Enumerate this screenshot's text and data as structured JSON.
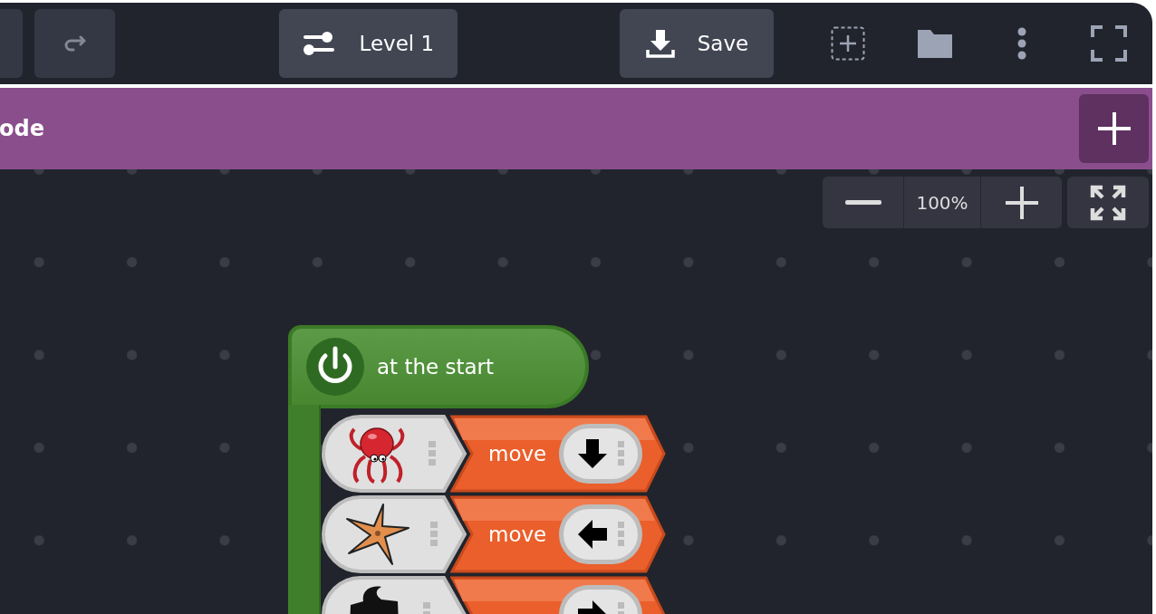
{
  "toolbar": {
    "redo_button": {
      "disabled": true
    },
    "level_button": {
      "label": "Level 1"
    },
    "save_button": {
      "label": "Save"
    }
  },
  "category_bar": {
    "title": "ode"
  },
  "zoom_controls": {
    "reading": "100%"
  },
  "script": {
    "hat_label": "at the start",
    "rows": [
      {
        "label": "move",
        "kind": "down"
      },
      {
        "label": "move",
        "kind": "left"
      },
      {
        "kind": "right"
      }
    ]
  }
}
